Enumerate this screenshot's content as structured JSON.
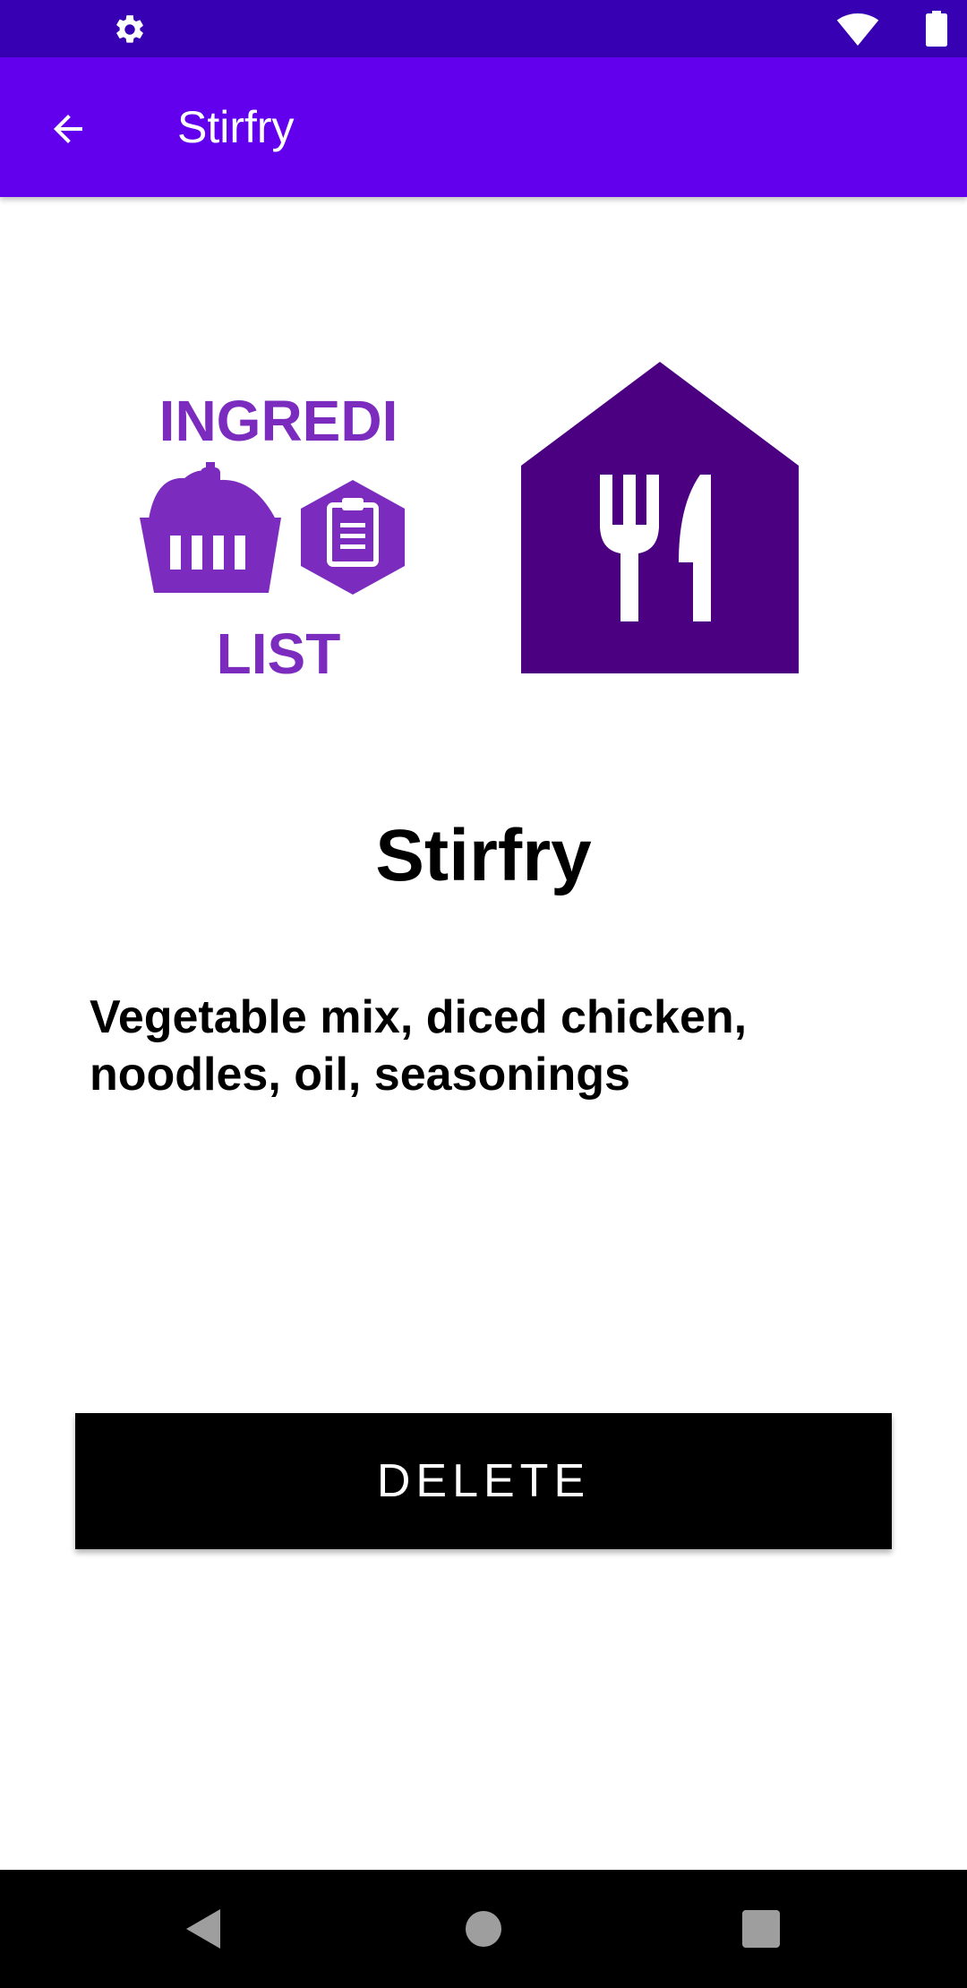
{
  "status_bar": {
    "background": "#3700b3",
    "icons": [
      "settings-gear-icon",
      "wifi-icon",
      "battery-icon"
    ]
  },
  "app_bar": {
    "title": "Stirfry",
    "background": "#6200ee",
    "back_icon": "arrow-back-icon"
  },
  "images": {
    "ingredients_logo": {
      "line1": "INGREDI",
      "line2": "LIST",
      "color": "#7b2cbf"
    },
    "restaurant_icon": {
      "color": "#4b0082",
      "icon": "fork-knife-icon"
    }
  },
  "recipe": {
    "name": "Stirfry",
    "ingredients": "Vegetable mix, diced chicken, noodles, oil, seasonings"
  },
  "actions": {
    "delete_label": "DELETE"
  },
  "nav_bar": {
    "icons": [
      "back-triangle-icon",
      "home-circle-icon",
      "recents-square-icon"
    ]
  }
}
